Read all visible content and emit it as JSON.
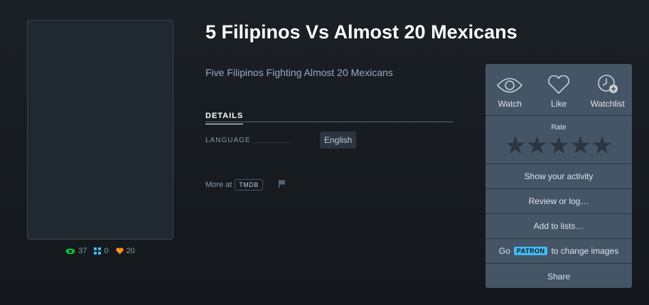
{
  "film": {
    "title": "5 Filipinos Vs Almost 20 Mexicans",
    "tagline": "Five Filipinos Fighting Almost 20 Mexicans"
  },
  "stats": {
    "watches": "37",
    "lists": "0",
    "likes": "20"
  },
  "details": {
    "tab_label": "DETAILS",
    "language_label": "LANGUAGE",
    "language_value": "English"
  },
  "more_at": {
    "label": "More at",
    "tmdb": "TMDB"
  },
  "panel": {
    "watch": "Watch",
    "like": "Like",
    "watchlist": "Watchlist",
    "rate": "Rate",
    "show_activity": "Show your activity",
    "review": "Review or log…",
    "add_lists": "Add to lists…",
    "go": "Go",
    "patron": "PATRON",
    "change_images": "to change images",
    "share": "Share"
  },
  "colors": {
    "background": "#14181c",
    "panel": "#445566",
    "watch_green": "#00c030",
    "list_blue": "#40bcf4",
    "like_orange": "#ff9010"
  }
}
